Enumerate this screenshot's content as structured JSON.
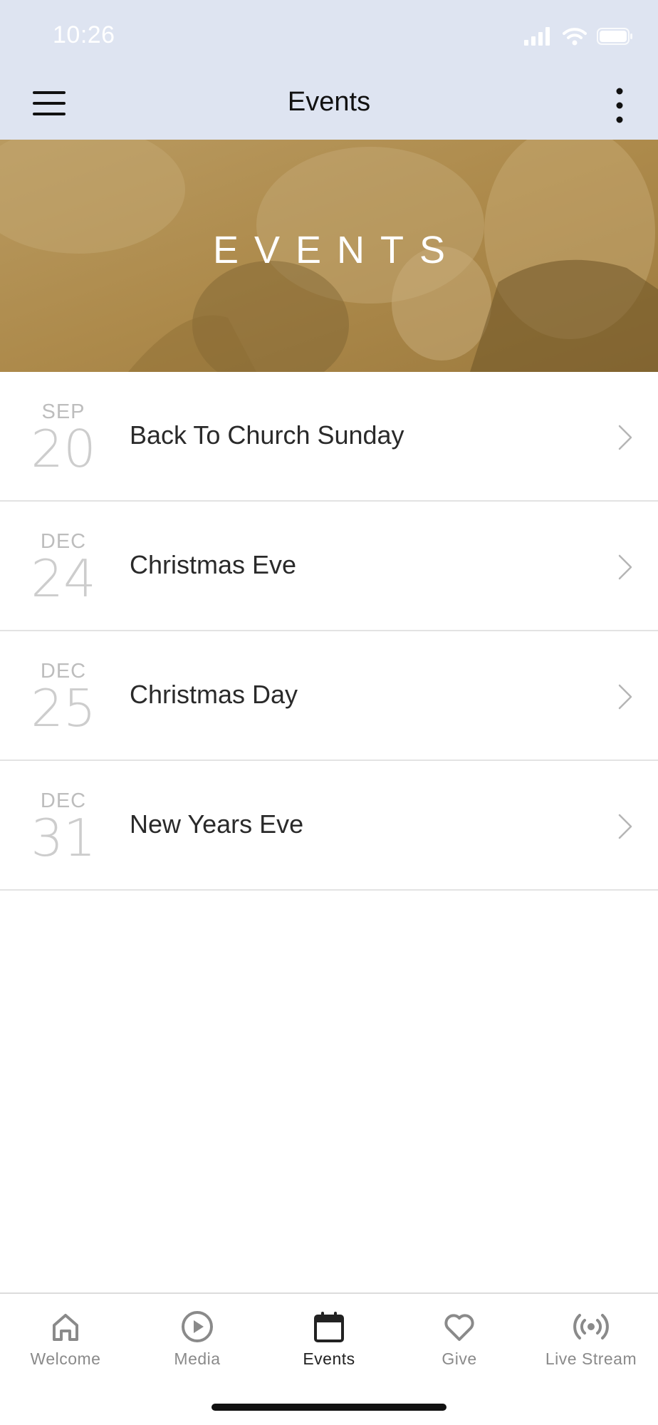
{
  "status_bar": {
    "time": "10:26"
  },
  "nav": {
    "title": "Events",
    "menu_icon": "hamburger-menu-icon",
    "more_icon": "vertical-more-icon"
  },
  "hero": {
    "title": "EVENTS"
  },
  "events": [
    {
      "month": "SEP",
      "day": "20",
      "title": "Back To Church Sunday"
    },
    {
      "month": "DEC",
      "day": "24",
      "title": "Christmas Eve"
    },
    {
      "month": "DEC",
      "day": "25",
      "title": "Christmas Day"
    },
    {
      "month": "DEC",
      "day": "31",
      "title": "New Years Eve"
    }
  ],
  "tabs": [
    {
      "label": "Welcome",
      "icon": "home-icon"
    },
    {
      "label": "Media",
      "icon": "play-circle-icon"
    },
    {
      "label": "Events",
      "icon": "calendar-icon",
      "active": true
    },
    {
      "label": "Give",
      "icon": "heart-icon"
    },
    {
      "label": "Live Stream",
      "icon": "broadcast-icon"
    }
  ],
  "colors": {
    "header_bg": "#dee4f1",
    "hero_tint": "#b08d4e",
    "active_tab": "#222222",
    "inactive_tab": "#8a8a8a"
  }
}
